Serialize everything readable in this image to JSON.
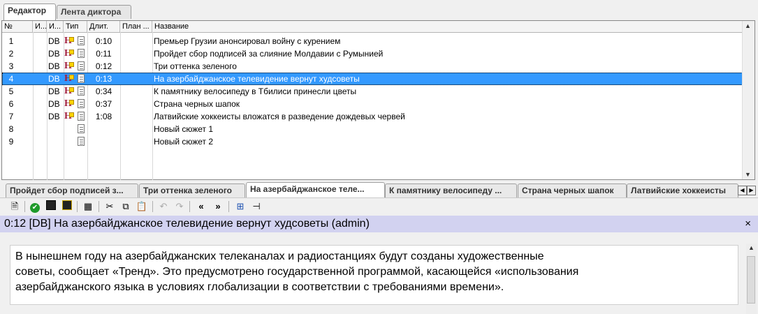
{
  "top_tabs": [
    "Редактор",
    "Лента диктора"
  ],
  "columns": [
    "№",
    "И...",
    "И...",
    "Тип",
    "Длит.",
    "План ...",
    "Название"
  ],
  "rows": [
    {
      "num": "1",
      "src": "DB",
      "dur": "0:10",
      "title": "Премьер Грузии анонсировал войну с курением",
      "has_h": true
    },
    {
      "num": "2",
      "src": "DB",
      "dur": "0:11",
      "title": "Пройдет сбор подписей за слияние Молдавии с Румынией",
      "has_h": true
    },
    {
      "num": "3",
      "src": "DB",
      "dur": "0:12",
      "title": "Три оттенка зеленого",
      "has_h": true
    },
    {
      "num": "4",
      "src": "DB",
      "dur": "0:13",
      "title": "На азербайджанское телевидение вернут худсоветы",
      "has_h": true,
      "selected": true
    },
    {
      "num": "5",
      "src": "DB",
      "dur": "0:34",
      "title": "К памятнику велосипеду в Тбилиси принесли цветы",
      "has_h": true
    },
    {
      "num": "6",
      "src": "DB",
      "dur": "0:37",
      "title": "Страна черных шапок",
      "has_h": true
    },
    {
      "num": "7",
      "src": "DB",
      "dur": "1:08",
      "title": "Латвийские хоккеисты вложатся в разведение дождевых червей",
      "has_h": true
    },
    {
      "num": "8",
      "src": "",
      "dur": "",
      "title": "Новый сюжет 1",
      "has_h": false
    },
    {
      "num": "9",
      "src": "",
      "dur": "",
      "title": "Новый сюжет 2",
      "has_h": false
    }
  ],
  "story_tabs": [
    "Пройдет сбор подписей з...",
    "Три оттенка зеленого",
    "На азербайджанское теле...",
    "К памятнику велосипеду ...",
    "Страна черных шапок",
    "Латвийские хоккеисты"
  ],
  "active_story_tab": 2,
  "editor": {
    "caption": "0:12  [DB] На азербайджанское телевидение вернут худсоветы (admin)",
    "close_glyph": "×",
    "text_lines": [
      "В нынешнем году на азербайджанских телеканалах и радиостанциях будут созданы художественные",
      "советы, сообщает «Тренд». Это предусмотрено государственной программой, касающейся «использования",
      "азербайджанского языка в условиях глобализации в соответствии с требованиями времени»."
    ]
  },
  "colors": {
    "selection": "#3399ff",
    "caption_bg": "#d2d2f0",
    "h_icon": "#a01c3c"
  }
}
